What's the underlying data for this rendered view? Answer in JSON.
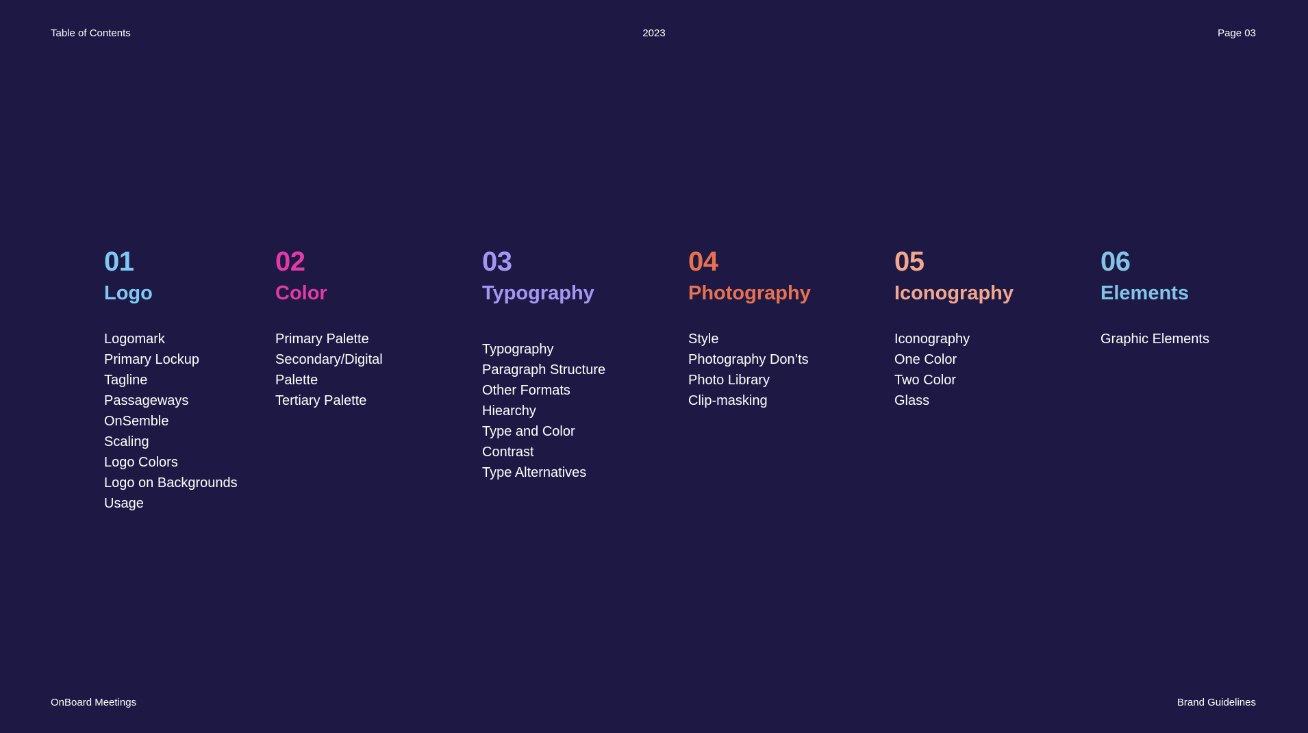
{
  "header": {
    "left": "Table of Contents",
    "center": "2023",
    "right": "Page 03"
  },
  "footer": {
    "left": "OnBoard Meetings",
    "right": "Brand Guidelines"
  },
  "sections": [
    {
      "number": "01",
      "title": "Logo",
      "color": "#7fc8f4",
      "items": [
        "Logomark",
        "Primary Lockup",
        "Tagline",
        "Passageways",
        "OnSemble",
        "Scaling",
        "Logo Colors",
        "Logo on Backgrounds",
        "Usage"
      ]
    },
    {
      "number": "02",
      "title": "Color",
      "color": "#e33aa6",
      "items": [
        "Primary Palette",
        "Secondary/Digital",
        "Palette",
        "Tertiary Palette"
      ]
    },
    {
      "number": "03",
      "title": "Typography",
      "color": "#a596f2",
      "items": [
        "Typography",
        "Paragraph Structure",
        "Other Formats",
        "Hiearchy",
        "Type and Color",
        "Contrast",
        "Type Alternatives"
      ]
    },
    {
      "number": "04",
      "title": "Photography",
      "color": "#e8714f",
      "items": [
        "Style",
        "Photography Don’ts",
        "Photo Library",
        "Clip-masking"
      ]
    },
    {
      "number": "05",
      "title": "Iconography",
      "color": "#f2a68c",
      "items": [
        "Iconography",
        "One Color",
        "Two Color",
        "Glass"
      ]
    },
    {
      "number": "06",
      "title": "Elements",
      "color": "#82c3e6",
      "items": [
        "Graphic Elements"
      ]
    }
  ]
}
